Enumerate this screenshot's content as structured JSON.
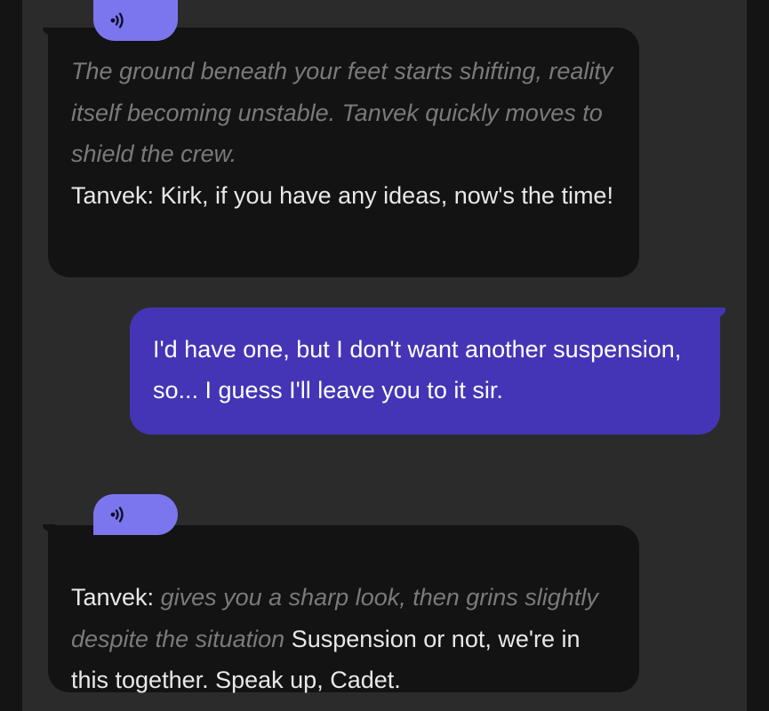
{
  "messages": [
    {
      "role": "character",
      "speak_icon": "speaker-waves-icon",
      "narration": "The ground beneath your feet starts shifting, reality itself becoming unstable. Tanvek quickly moves to shield the crew.",
      "speech": "Tanvek: Kirk, if you have any ideas, now's the time!"
    },
    {
      "role": "user",
      "text": "I'd have one, but I don't want another suspension, so... I guess I'll leave you to it sir."
    },
    {
      "role": "character",
      "speak_icon": "speaker-waves-icon",
      "speaker_prefix": "Tanvek:",
      "action": "gives you a sharp look, then grins slightly despite the situation",
      "speech": "Suspension or not, we're in this together. Speak up, Cadet."
    }
  ],
  "colors": {
    "background": "#141414",
    "chat_panel": "#2b2b2b",
    "character_bubble": "#131313",
    "user_bubble": "#4335b5",
    "speak_button": "#7c76ee",
    "action_text": "#7a7a7a"
  }
}
